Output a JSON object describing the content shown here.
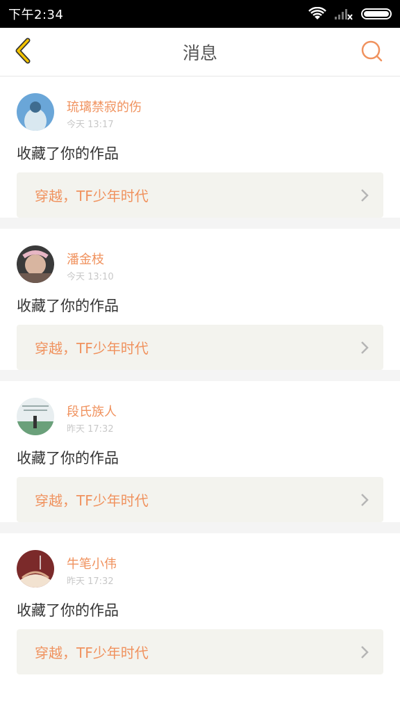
{
  "status_bar": {
    "time": "下午2:34",
    "icons": [
      "wifi-icon",
      "signal-icon",
      "battery-icon"
    ]
  },
  "header": {
    "title": "消息",
    "back_icon": "chevron-left-icon",
    "search_icon": "search-icon"
  },
  "colors": {
    "accent_orange": "#f0925e",
    "back_yellow": "#f3c300",
    "work_box_bg": "#f3f3ee",
    "divider": "#f4f4f4"
  },
  "messages": [
    {
      "username": "琉璃禁寂的伤",
      "time": "今天 13:17",
      "action": "收藏了你的作品",
      "work_title": "穿越，TF少年时代",
      "avatar_colors": [
        "#6aa6d8",
        "#d9e8f0",
        "#3f6c8f"
      ]
    },
    {
      "username": "潘金枝",
      "time": "今天 13:10",
      "action": "收藏了你的作品",
      "work_title": "穿越，TF少年时代",
      "avatar_colors": [
        "#3a3a3a",
        "#e7b6c4",
        "#6f5a50"
      ]
    },
    {
      "username": "段氏族人",
      "time": "昨天 17:32",
      "action": "收藏了你的作品",
      "work_title": "穿越，TF少年时代",
      "avatar_colors": [
        "#e8eef0",
        "#6aa07a",
        "#333333"
      ]
    },
    {
      "username": "牛笔小伟",
      "time": "昨天 17:32",
      "action": "收藏了你的作品",
      "work_title": "穿越，TF少年时代",
      "avatar_colors": [
        "#7b2a2a",
        "#d9a98a",
        "#f2e2d0"
      ]
    }
  ]
}
